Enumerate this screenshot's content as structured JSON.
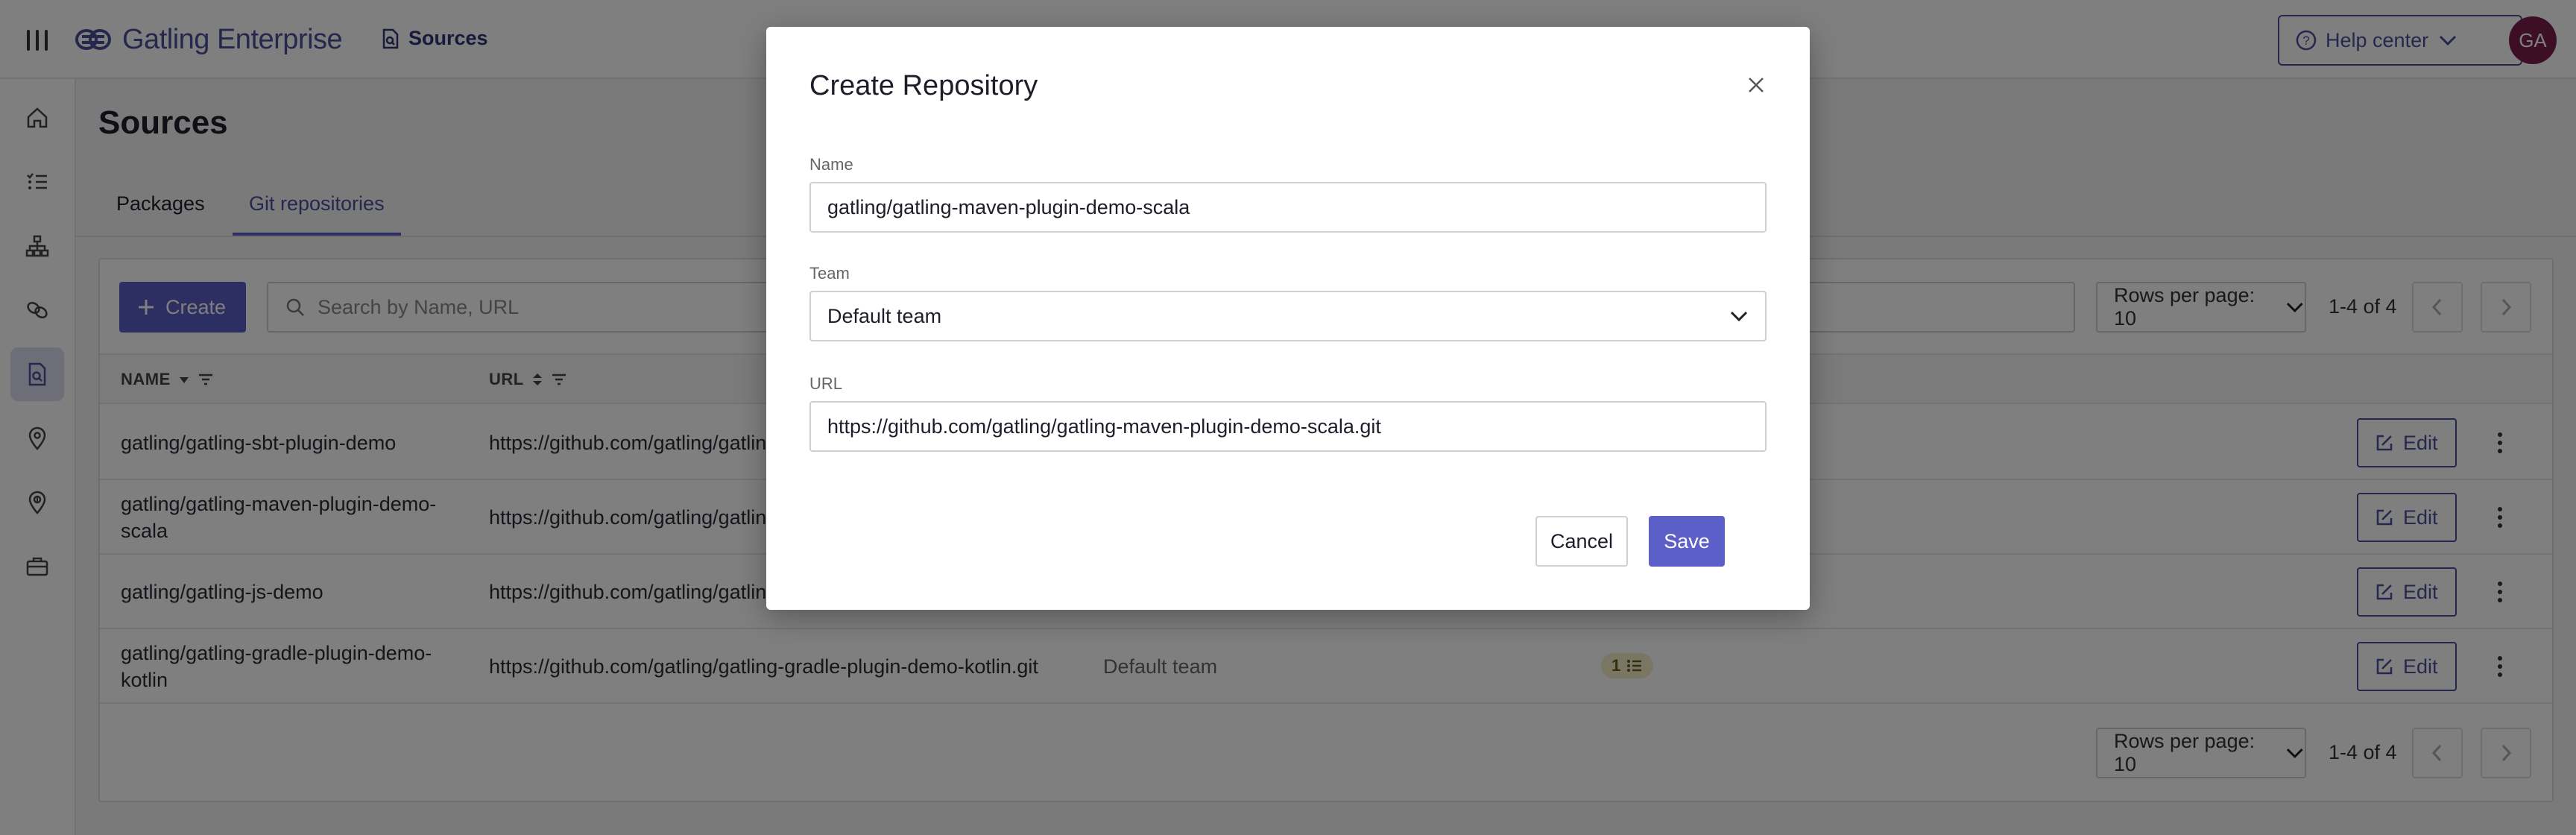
{
  "app": {
    "logo_text": "Gatling Enterprise",
    "breadcrumb": "Sources",
    "help_center": "Help center",
    "avatar_initials": "GA"
  },
  "colors": {
    "accent": "#5b5fc7",
    "brand": "#4b4f9a",
    "avatar": "#7a1f4f"
  },
  "sidebar": {
    "items": [
      {
        "icon": "home-icon"
      },
      {
        "icon": "list-icon"
      },
      {
        "icon": "sitemap-icon"
      },
      {
        "icon": "link-icon"
      },
      {
        "icon": "file-search-icon",
        "active": true
      },
      {
        "icon": "location-pin-icon"
      },
      {
        "icon": "location-pin-alt-icon"
      },
      {
        "icon": "briefcase-icon"
      }
    ]
  },
  "page": {
    "title": "Sources",
    "tabs": [
      {
        "label": "Packages"
      },
      {
        "label": "Git repositories",
        "active": true
      }
    ]
  },
  "toolbar": {
    "create_label": "Create",
    "search_placeholder": "Search by Name, URL",
    "rows_per_page": "Rows per page: 10",
    "range": "1-4 of 4"
  },
  "table": {
    "columns": [
      "NAME",
      "URL"
    ],
    "rows": [
      {
        "name": "gatling/gatling-sbt-plugin-demo",
        "url": "https://github.com/gatling/gatlin",
        "team": "",
        "badge": "",
        "edit": "Edit"
      },
      {
        "name": "gatling/gatling-maven-plugin-demo-scala",
        "url": "https://github.com/gatling/gatlin",
        "team": "",
        "badge": "",
        "edit": "Edit"
      },
      {
        "name": "gatling/gatling-js-demo",
        "url": "https://github.com/gatling/gatlin",
        "team": "",
        "badge": "",
        "edit": "Edit"
      },
      {
        "name": "gatling/gatling-gradle-plugin-demo-kotlin",
        "url": "https://github.com/gatling/gatling-gradle-plugin-demo-kotlin.git",
        "team": "Default team",
        "badge": "1",
        "edit": "Edit"
      }
    ]
  },
  "footer": {
    "rows_per_page": "Rows per page: 10",
    "range": "1-4 of 4"
  },
  "modal": {
    "title": "Create Repository",
    "name_label": "Name",
    "name_value": "gatling/gatling-maven-plugin-demo-scala",
    "team_label": "Team",
    "team_value": "Default team",
    "url_label": "URL",
    "url_value": "https://github.com/gatling/gatling-maven-plugin-demo-scala.git",
    "cancel_label": "Cancel",
    "save_label": "Save"
  }
}
